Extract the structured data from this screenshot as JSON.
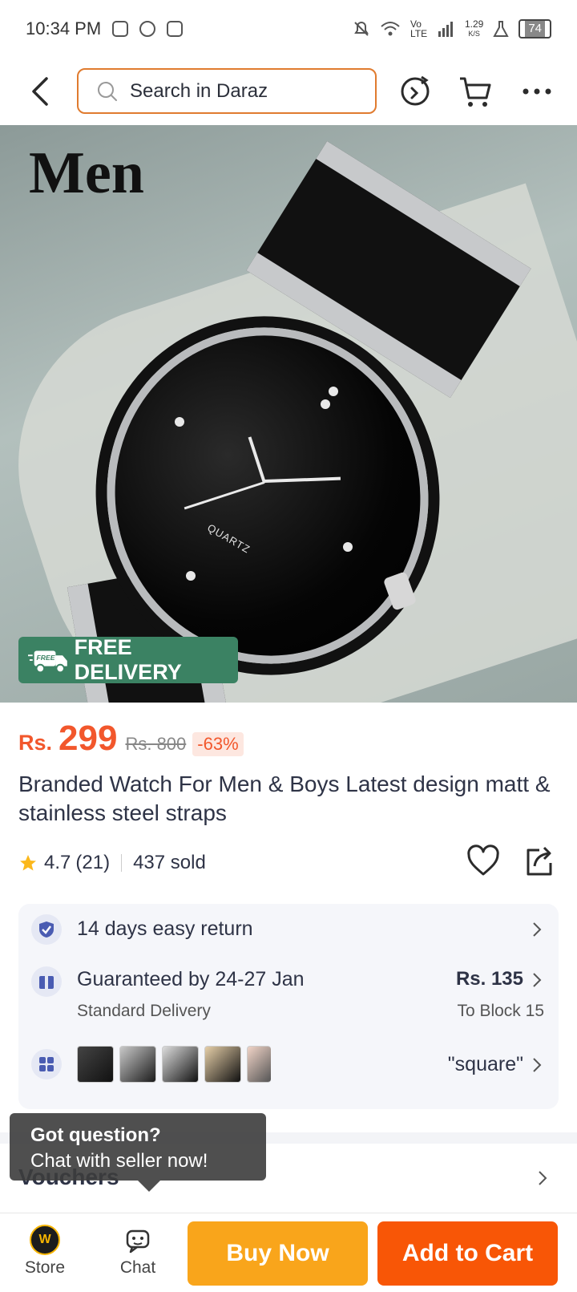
{
  "status_bar": {
    "time": "10:34 PM",
    "net_speed": "1.29",
    "net_unit": "K/S",
    "network_label": "Vo LTE",
    "battery": "74"
  },
  "header": {
    "search_placeholder": "Search in Daraz"
  },
  "hero": {
    "overlay_title": "Men",
    "dial_text": "QUARTZ",
    "free_delivery_tag": "FREE",
    "free_delivery_label": "FREE DELIVERY"
  },
  "pricing": {
    "currency": "Rs.",
    "price": "299",
    "original_price": "Rs. 800",
    "discount": "-63%"
  },
  "product": {
    "title": "Branded Watch For Men & Boys Latest design matt & stainless steel straps",
    "rating": "4.7",
    "reviews": "(21)",
    "sold": "437 sold"
  },
  "services": {
    "return_label": "14 days easy return",
    "delivery_label": "Guaranteed by 24-27 Jan",
    "delivery_type": "Standard Delivery",
    "shipping_price": "Rs. 135",
    "shipping_destination": "To Block 15",
    "variant_label": "\"square\""
  },
  "vouchers": {
    "title": "Vouchers"
  },
  "tooltip": {
    "title": "Got question?",
    "subtitle": "Chat with seller now!"
  },
  "bottom_bar": {
    "store_label": "Store",
    "chat_label": "Chat",
    "buy_now_label": "Buy Now",
    "add_to_cart_label": "Add to Cart"
  },
  "colors": {
    "accent_orange": "#f85606",
    "price_orange": "#f2572c",
    "buy_now_yellow": "#f9a51b",
    "delivery_green": "#3b8263"
  }
}
